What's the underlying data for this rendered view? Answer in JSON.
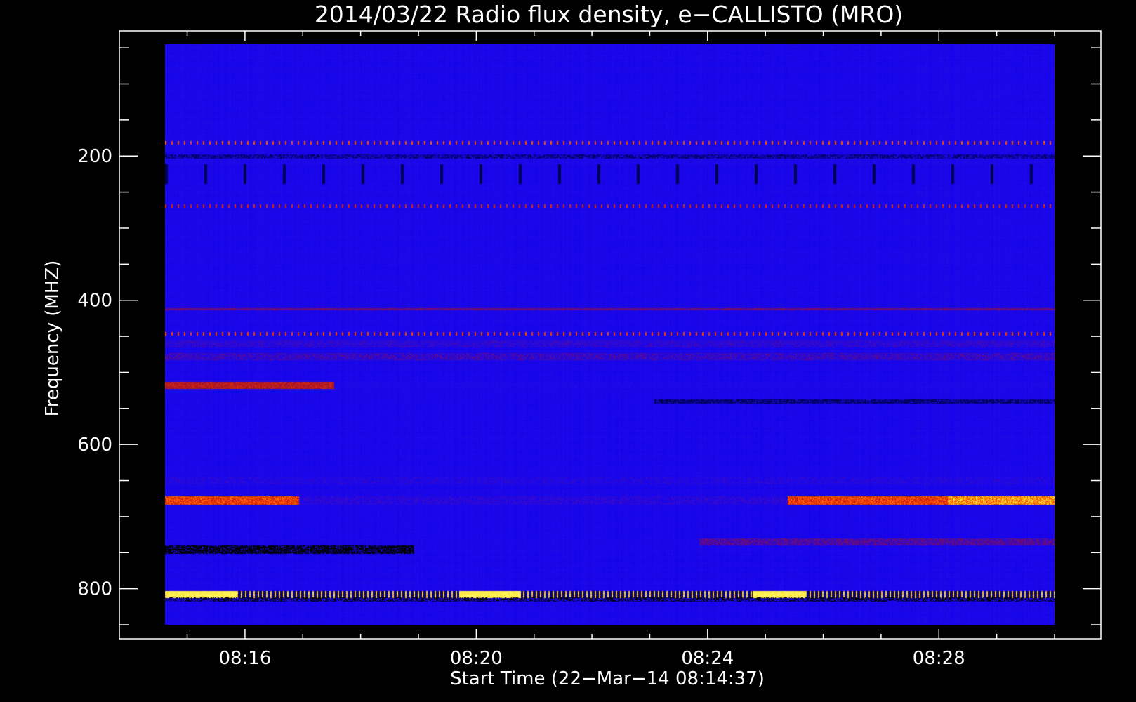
{
  "chart_data": {
    "type": "heatmap",
    "title": "2014/03/22  Radio flux density, e−CALLISTO (MRO)",
    "xlabel": "Start Time (22−Mar−14 08:14:37)",
    "ylabel": "Frequency (MHZ)",
    "x_ticks": [
      "08:16",
      "08:20",
      "08:24",
      "08:28"
    ],
    "x_tick_values_min": [
      16,
      20,
      24,
      28
    ],
    "xlim_min": [
      14.617,
      30.0
    ],
    "y_ticks": [
      200,
      400,
      600,
      800
    ],
    "ylim": [
      850,
      45
    ],
    "colormap": [
      "#000000",
      "#0000ff",
      "#7b0a5e",
      "#c81e0a",
      "#ff5000",
      "#ffd000",
      "#ffff80"
    ],
    "colors": {
      "background": "#000000",
      "axes": "#ffffff",
      "base": "#1b10ee"
    },
    "bands": [
      {
        "freq_mhz": 181,
        "level": 0.82,
        "style": "ticks"
      },
      {
        "freq_mhz": 200,
        "level": 0.05,
        "style": "dark"
      },
      {
        "freq_mhz": 269,
        "level": 0.75,
        "style": "ticks"
      },
      {
        "freq_mhz": 412,
        "level": 0.6,
        "style": "line"
      },
      {
        "freq_mhz": 446,
        "level": 0.8,
        "style": "ticks"
      },
      {
        "freq_mhz": 460,
        "level": 0.45,
        "style": "patchy"
      },
      {
        "freq_mhz": 478,
        "level": 0.5,
        "style": "patchy"
      },
      {
        "freq_mhz": 518,
        "level": 0.7,
        "style": "left-strong"
      },
      {
        "freq_mhz": 540,
        "level": 0.05,
        "style": "right-dark"
      },
      {
        "freq_mhz": 650,
        "level": 0.4,
        "style": "patchy"
      },
      {
        "freq_mhz": 677,
        "level": 0.75,
        "style": "ends-strong"
      },
      {
        "freq_mhz": 745,
        "level": 0.0,
        "style": "left-dark"
      },
      {
        "freq_mhz": 735,
        "level": 0.55,
        "style": "right-strong"
      },
      {
        "freq_mhz": 808,
        "level": 0.95,
        "style": "bright"
      },
      {
        "freq_mhz": 814,
        "level": 0.0,
        "style": "dark"
      }
    ]
  }
}
